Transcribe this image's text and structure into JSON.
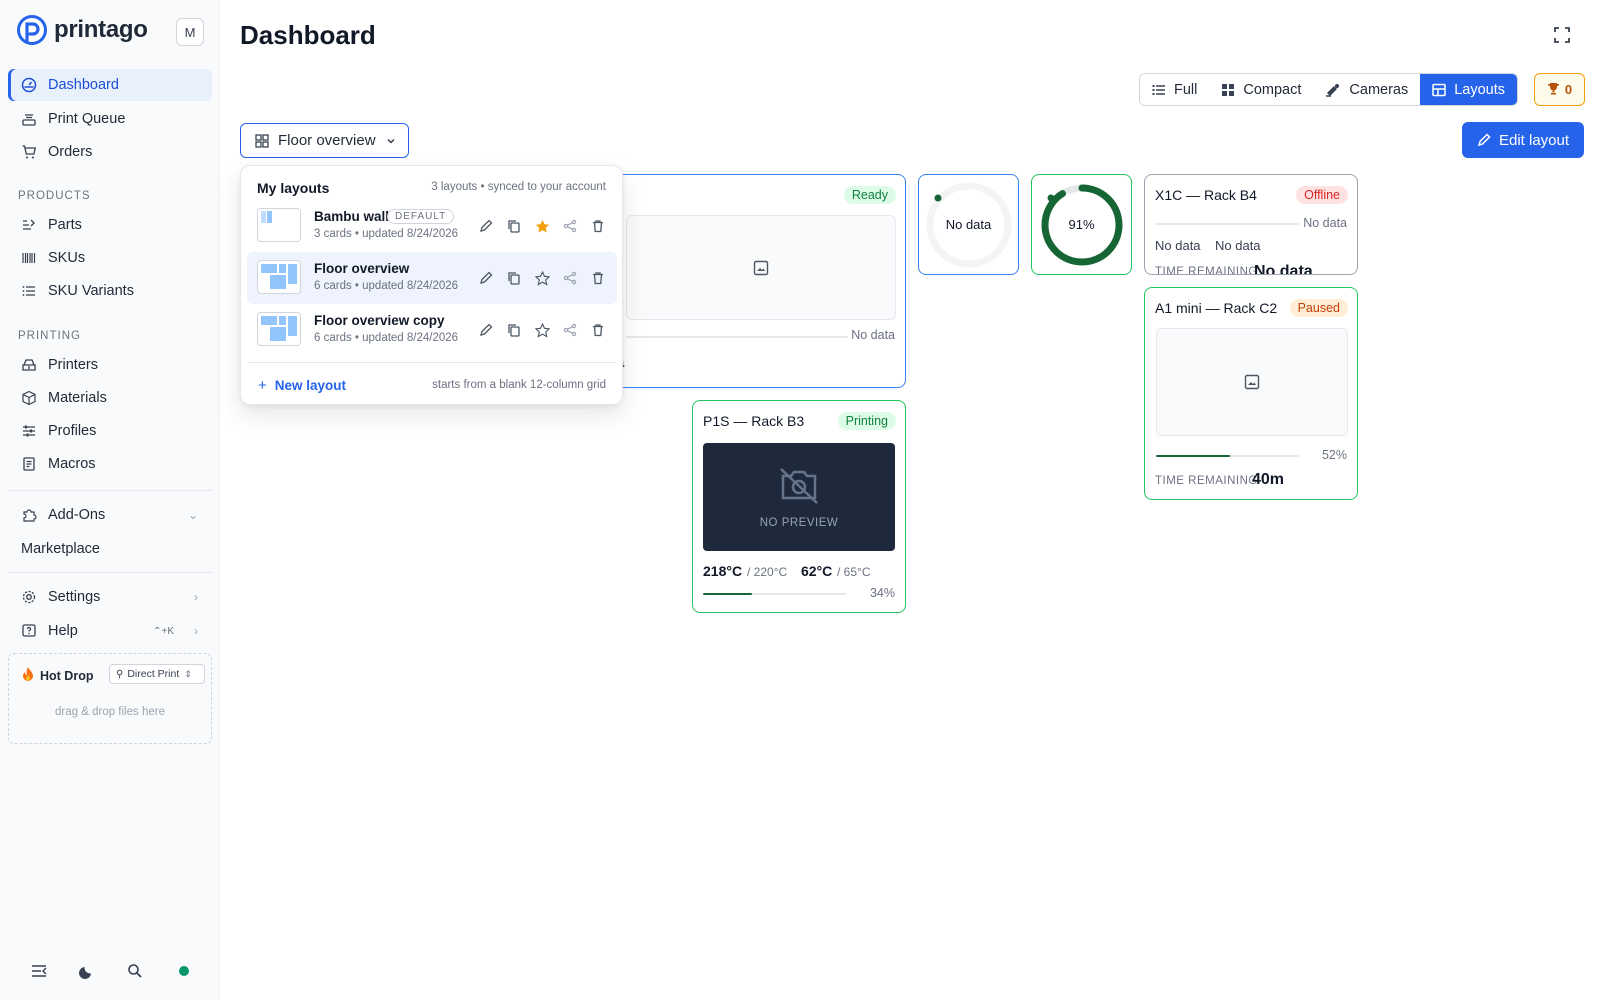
{
  "brand": {
    "name": "printago",
    "avatar_initial": "M"
  },
  "sidebar": {
    "nav": [
      {
        "label": "Dashboard",
        "icon": "dashboard-icon",
        "active": true
      },
      {
        "label": "Print Queue",
        "icon": "print-queue-icon"
      },
      {
        "label": "Orders",
        "icon": "cart-icon"
      }
    ],
    "products_label": "PRODUCTS",
    "products": [
      {
        "label": "Parts",
        "icon": "parts-icon"
      },
      {
        "label": "SKUs",
        "icon": "barcode-icon"
      },
      {
        "label": "SKU Variants",
        "icon": "list-icon"
      }
    ],
    "printing_label": "PRINTING",
    "printing": [
      {
        "label": "Printers",
        "icon": "printer-icon"
      },
      {
        "label": "Materials",
        "icon": "cube-icon"
      },
      {
        "label": "Profiles",
        "icon": "sliders-icon"
      },
      {
        "label": "Macros",
        "icon": "macro-icon"
      }
    ],
    "addons": "Add-Ons",
    "marketplace": "Marketplace",
    "settings": "Settings",
    "help": "Help",
    "help_shortcut": "⌃+K",
    "hotdrop": {
      "title": "Hot Drop",
      "mode": "Direct Print",
      "hint": "drag & drop files here"
    }
  },
  "header": {
    "title": "Dashboard",
    "views": [
      {
        "label": "Full",
        "icon": "list-icon"
      },
      {
        "label": "Compact",
        "icon": "grid-icon"
      },
      {
        "label": "Cameras",
        "icon": "camera-icon"
      },
      {
        "label": "Layouts",
        "icon": "layout-icon",
        "active": true
      }
    ],
    "trophy_count": "0",
    "layout_select": "Floor overview",
    "edit_layout": "Edit layout"
  },
  "cards": {
    "ready": {
      "status": "Ready",
      "no_data": "No data",
      "partial_value": "ta"
    },
    "gauge1": {
      "label": "No data"
    },
    "gauge2": {
      "label": "91%",
      "value": 0.91
    },
    "x1c": {
      "title": "X1C — Rack B4",
      "status": "Offline",
      "no_data": "No data",
      "nozzle": "No data",
      "bed": "No data",
      "time_label": "TIME REMAINING",
      "time_value": "No data"
    },
    "a1mini": {
      "title": "A1 mini — Rack C2",
      "status": "Paused",
      "progress_text": "52%",
      "progress": 0.52,
      "time_label": "TIME REMAINING",
      "time_value": "40m"
    },
    "p1s": {
      "title": "P1S — Rack B3",
      "status": "Printing",
      "preview": "NO PREVIEW",
      "nozzle": "218°C",
      "nozzle_target": "/ 220°C",
      "bed": "62°C",
      "bed_target": "/ 65°C",
      "progress_text": "34%",
      "progress": 0.34
    }
  },
  "dropdown": {
    "heading": "My layouts",
    "subheading": "3 layouts • synced to your account",
    "items": [
      {
        "name": "Bambu wall",
        "default_badge": "DEFAULT",
        "meta": "3 cards • updated 8/24/2026",
        "starred": true
      },
      {
        "name": "Floor overview",
        "meta": "6 cards • updated 8/24/2026",
        "selected": true
      },
      {
        "name": "Floor overview copy",
        "meta": "6 cards • updated 8/24/2026"
      }
    ],
    "new_layout": "New layout",
    "new_hint": "starts from a blank 12-column grid"
  },
  "colors": {
    "accent": "#2563eb",
    "success": "#16a34a",
    "danger": "#dc2626",
    "warning": "#f59e0b"
  }
}
